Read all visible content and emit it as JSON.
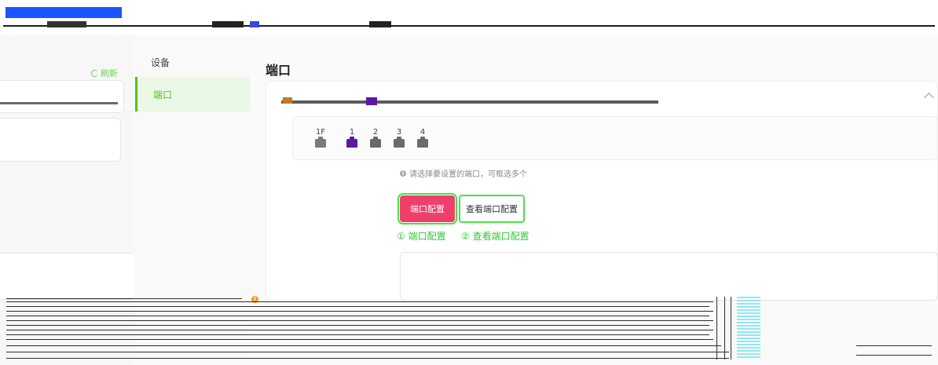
{
  "topbar": {
    "title": "",
    "right_text": "",
    "brand_color": "#1a56ff"
  },
  "left_panel": {
    "refresh_label": "刷新",
    "refresh_icon": "refresh-icon"
  },
  "nav": {
    "items": [
      {
        "label": "设备",
        "active": false
      },
      {
        "label": "端口",
        "active": true
      }
    ]
  },
  "main": {
    "title": "端口",
    "ports": [
      {
        "label": "1F",
        "state": "default"
      },
      {
        "label": "1",
        "state": "selected"
      },
      {
        "label": "2",
        "state": "default"
      },
      {
        "label": "3",
        "state": "default"
      },
      {
        "label": "4",
        "state": "default"
      }
    ],
    "hint": "请选择要设置的端口，可框选多个",
    "buttons": {
      "port_config": "端口配置",
      "view_port_config": "查看端口配置"
    },
    "annotations": {
      "one": "① 端口配置",
      "two": "② 查看端口配置"
    },
    "warning": ""
  },
  "colors": {
    "accent_green": "#52c41a",
    "primary_button": "#ef3f6b",
    "highlight_outline": "#4be04b",
    "selected_port": "#5b17a6"
  }
}
